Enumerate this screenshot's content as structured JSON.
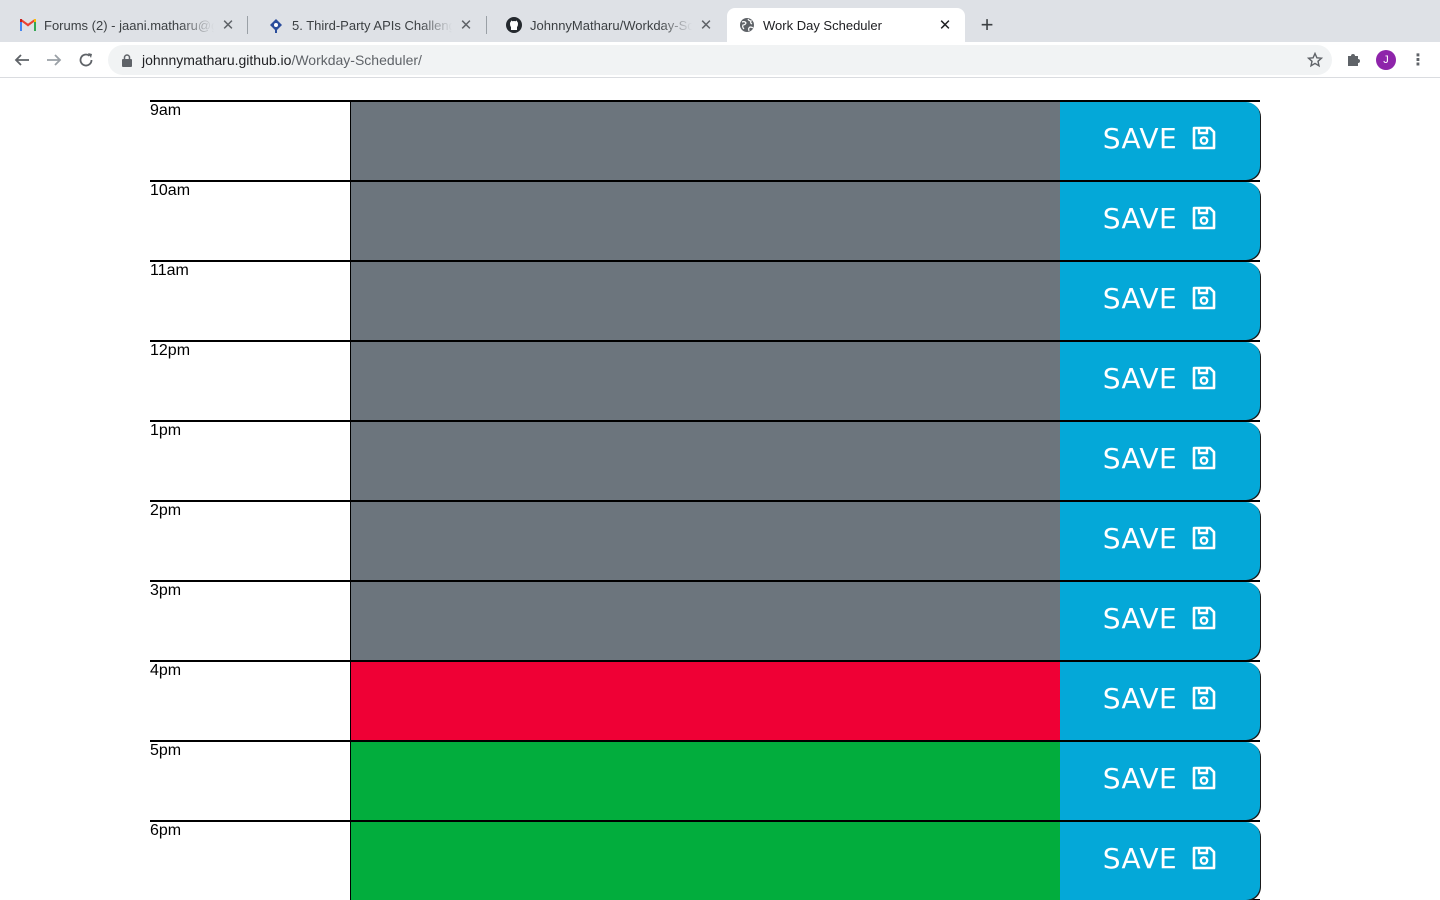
{
  "browser": {
    "tabs": [
      {
        "title": "Forums (2) - jaani.matharu@gmail.com",
        "favicon": "gmail-icon",
        "active": false
      },
      {
        "title": "5. Third-Party APIs Challenge: Work Day Scheduler",
        "favicon": "bootcamp-icon",
        "active": false
      },
      {
        "title": "JohnnyMatharu/Workday-Scheduler",
        "favicon": "github-icon",
        "active": false
      },
      {
        "title": "Work Day Scheduler",
        "favicon": "globe-icon",
        "active": true
      }
    ],
    "url_host": "johnnymatharu.github.io",
    "url_path": "/Workday-Scheduler/",
    "avatar_letter": "J"
  },
  "scheduler": {
    "save_label": "SAVE",
    "rows": [
      {
        "hour": "9am",
        "status": "past",
        "text": ""
      },
      {
        "hour": "10am",
        "status": "past",
        "text": ""
      },
      {
        "hour": "11am",
        "status": "past",
        "text": ""
      },
      {
        "hour": "12pm",
        "status": "past",
        "text": ""
      },
      {
        "hour": "1pm",
        "status": "past",
        "text": ""
      },
      {
        "hour": "2pm",
        "status": "past",
        "text": ""
      },
      {
        "hour": "3pm",
        "status": "past",
        "text": ""
      },
      {
        "hour": "4pm",
        "status": "present",
        "text": ""
      },
      {
        "hour": "5pm",
        "status": "future",
        "text": ""
      },
      {
        "hour": "6pm",
        "status": "future",
        "text": ""
      }
    ]
  },
  "colors": {
    "past": "#6c757d",
    "present": "#ef0035",
    "future": "#02ad3d",
    "save_button": "#04a8d8"
  }
}
